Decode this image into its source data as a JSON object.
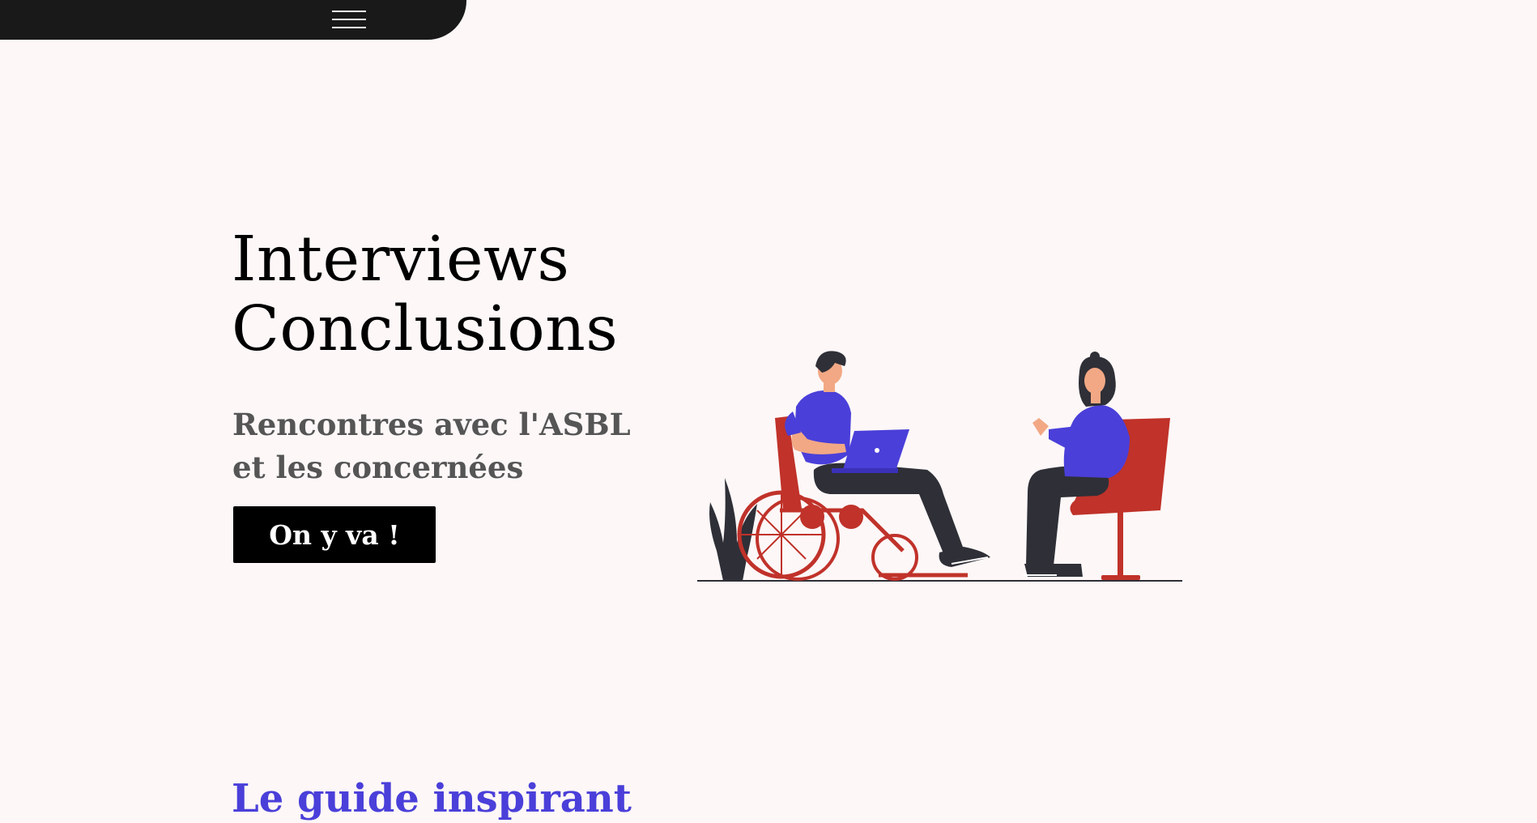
{
  "nav": {
    "menu_icon": "hamburger-menu-icon"
  },
  "hero": {
    "title_line1": "Interviews",
    "title_line2": "Conclusions",
    "subtitle_line1": "Rencontres avec l'ASBL",
    "subtitle_line2": "et les concernées",
    "cta_label": "On y va !"
  },
  "illustration": {
    "description_icon": "interview-illustration"
  },
  "next_section": {
    "heading": "Le guide inspirant"
  },
  "colors": {
    "background": "#fdf7f7",
    "nav_bar": "#191919",
    "accent_blue": "#4a3fd9",
    "accent_red": "#c0322a",
    "dark": "#2f2f37"
  }
}
